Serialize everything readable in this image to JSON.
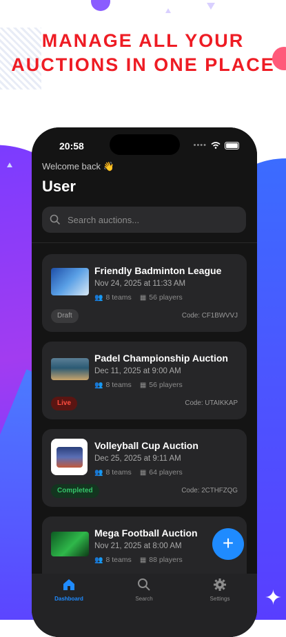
{
  "headline": "MANAGE ALL YOUR AUCTIONS IN ONE PLACE",
  "status_bar": {
    "time": "20:58"
  },
  "header": {
    "welcome": "Welcome back 👋",
    "user": "User"
  },
  "search": {
    "placeholder": "Search auctions..."
  },
  "auctions": [
    {
      "title": "Friendly Badminton League",
      "date": "Nov 24, 2025 at 11:33 AM",
      "teams": "8 teams",
      "players": "56 players",
      "status": "Draft",
      "code": "Code: CF1BWVVJ"
    },
    {
      "title": "Padel Championship Auction",
      "date": "Dec 11, 2025 at 9:00 AM",
      "teams": "8 teams",
      "players": "56 players",
      "status": "Live",
      "code": "Code: UTAIKKAP"
    },
    {
      "title": "Volleyball Cup Auction",
      "date": "Dec 25, 2025 at 9:11 AM",
      "teams": "8 teams",
      "players": "64 players",
      "status": "Completed",
      "code": "Code: 2CTHFZQG"
    },
    {
      "title": "Mega Football Auction",
      "date": "Nov 21, 2025 at 8:00 AM",
      "teams": "8 teams",
      "players": "88 players"
    }
  ],
  "fab": {
    "label": "+"
  },
  "tabs": [
    {
      "label": "Dashboard",
      "icon": "home-icon",
      "active": true
    },
    {
      "label": "Search",
      "icon": "search-icon",
      "active": false
    },
    {
      "label": "Settings",
      "icon": "gear-icon",
      "active": false
    }
  ],
  "colors": {
    "accent": "#1f8bff",
    "headline": "#ee1c24",
    "live": "#ff4d40",
    "completed": "#36c46a"
  }
}
